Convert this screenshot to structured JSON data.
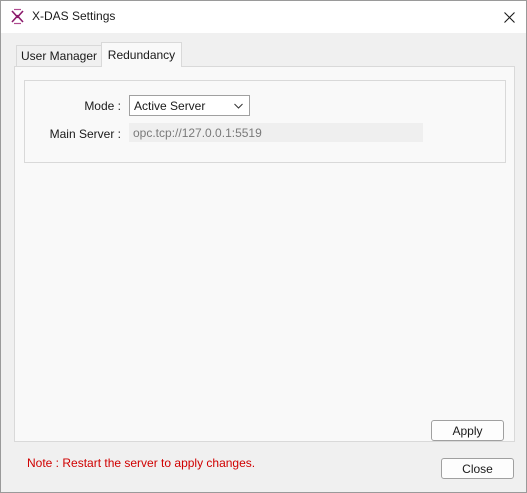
{
  "window": {
    "title": "X-DAS Settings",
    "close_glyph": "✕",
    "app_icon": "x-das-app-icon"
  },
  "tabs": [
    {
      "label": "User Manager",
      "active": false
    },
    {
      "label": "Redundancy",
      "active": true
    }
  ],
  "redundancy": {
    "mode_label": "Mode :",
    "mode_value": "Active Server",
    "main_server_label": "Main Server :",
    "main_server_value": "opc.tcp://127.0.0.1:5519"
  },
  "note": "Note : Restart the server to apply changes.",
  "buttons": {
    "apply": "Apply",
    "close": "Close"
  },
  "colors": {
    "note": "#d00000",
    "icon_accent": "#8b1a6b"
  }
}
